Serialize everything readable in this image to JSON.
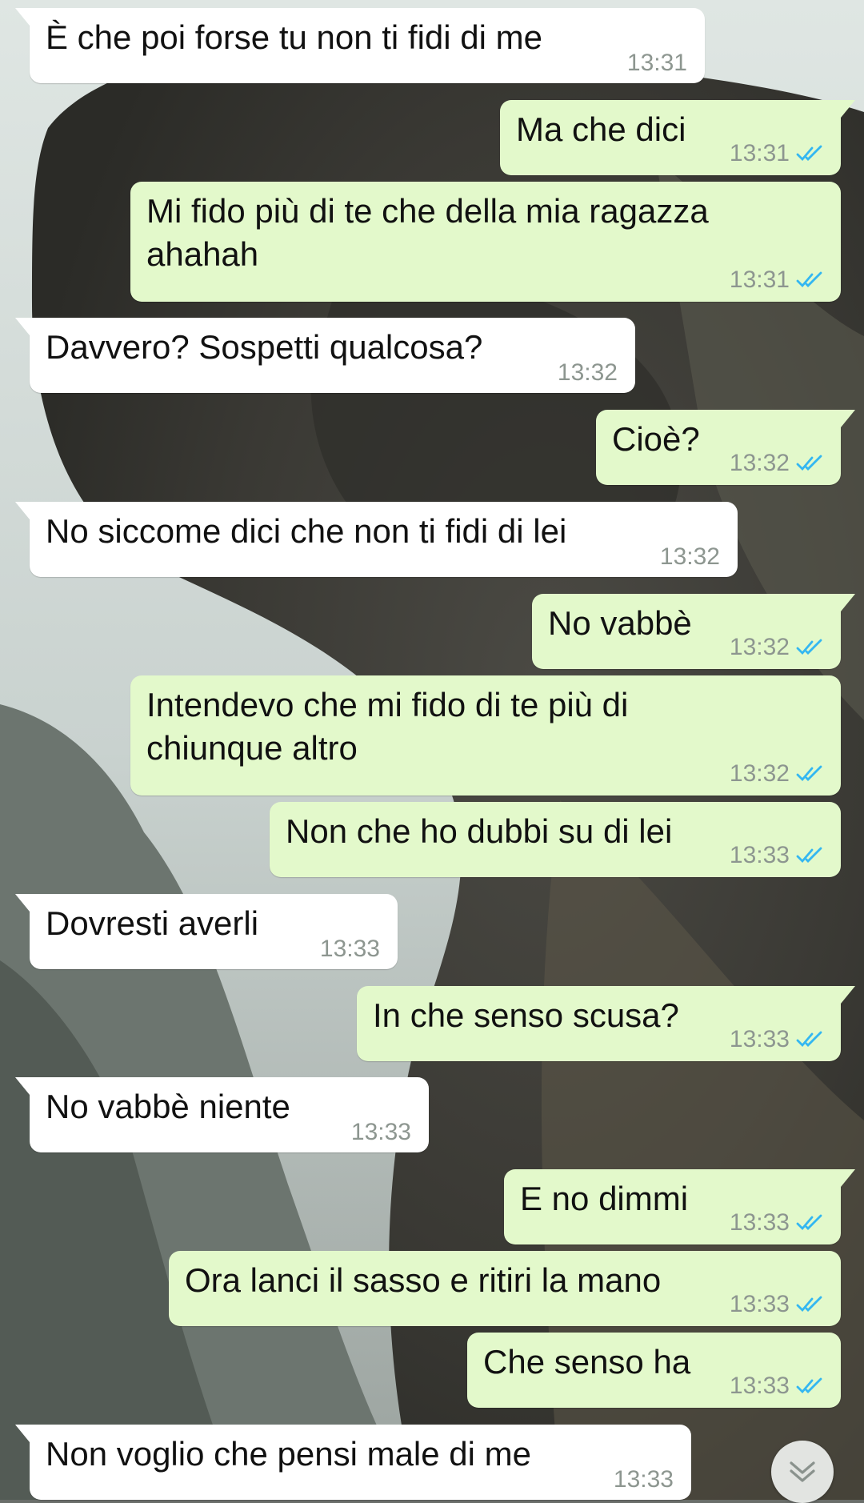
{
  "colors": {
    "incoming_bubble": "#ffffff",
    "outgoing_bubble": "#e3f9cb",
    "read_ticks": "#34b7f1",
    "timestamp": "#8d9690"
  },
  "wallpaper": {
    "icon": "wallpaper-photo"
  },
  "messages": [
    {
      "direction": "in",
      "text": "È che poi forse tu non ti fidi di me",
      "time": "13:31"
    },
    {
      "direction": "out",
      "text": "Ma che dici",
      "time": "13:31",
      "status": "read"
    },
    {
      "direction": "out",
      "text": "Mi fido più di te che della mia ragazza ahahah",
      "time": "13:31",
      "status": "read"
    },
    {
      "direction": "in",
      "text": "Davvero? Sospetti qualcosa?",
      "time": "13:32"
    },
    {
      "direction": "out",
      "text": "Cioè?",
      "time": "13:32",
      "status": "read"
    },
    {
      "direction": "in",
      "text": "No siccome dici che non ti fidi di lei",
      "time": "13:32"
    },
    {
      "direction": "out",
      "text": "No vabbè",
      "time": "13:32",
      "status": "read"
    },
    {
      "direction": "out",
      "text": "Intendevo che mi fido di te più di chiunque altro",
      "time": "13:32",
      "status": "read"
    },
    {
      "direction": "out",
      "text": "Non che ho dubbi su di lei",
      "time": "13:33",
      "status": "read"
    },
    {
      "direction": "in",
      "text": "Dovresti averli",
      "time": "13:33"
    },
    {
      "direction": "out",
      "text": "In che senso scusa?",
      "time": "13:33",
      "status": "read"
    },
    {
      "direction": "in",
      "text": "No vabbè niente",
      "time": "13:33"
    },
    {
      "direction": "out",
      "text": "E no dimmi",
      "time": "13:33",
      "status": "read"
    },
    {
      "direction": "out",
      "text": "Ora lanci il sasso e ritiri la mano",
      "time": "13:33",
      "status": "read"
    },
    {
      "direction": "out",
      "text": "Che senso ha",
      "time": "13:33",
      "status": "read"
    },
    {
      "direction": "in",
      "text": "Non voglio che pensi male di me",
      "time": "13:33"
    }
  ],
  "scroll_button": {
    "icon": "double-chevron-down-icon"
  }
}
